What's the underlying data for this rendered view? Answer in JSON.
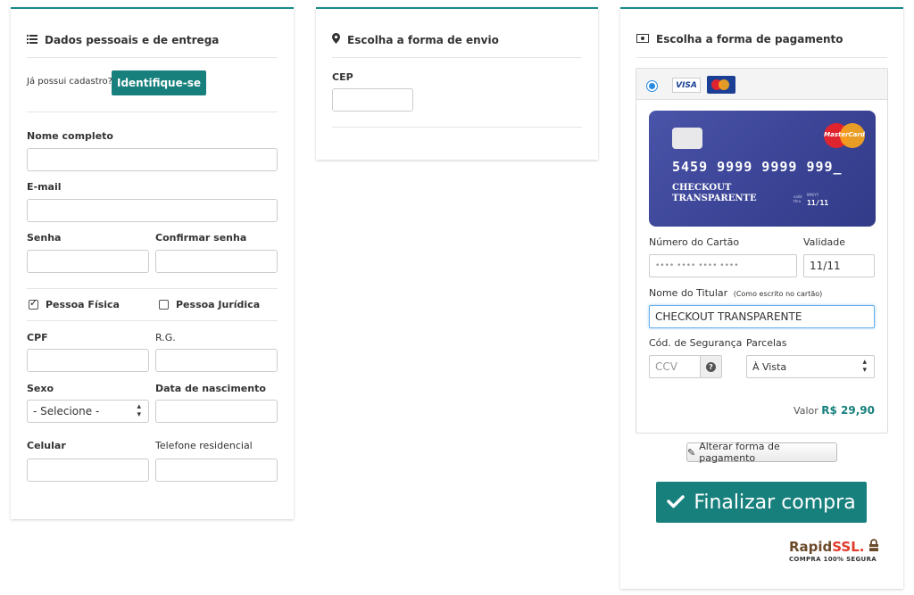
{
  "personal": {
    "title": "Dados pessoais e de entrega",
    "ja_possui": "Já possui cadastro?",
    "identifique": "Identifique-se",
    "nome_label": "Nome completo",
    "email_label": "E-mail",
    "senha_label": "Senha",
    "confirmar_label": "Confirmar senha",
    "pessoa_fisica": "Pessoa Física",
    "pessoa_juridica": "Pessoa Jurídica",
    "cpf_label": "CPF",
    "rg_label": "R.G.",
    "sexo_label": "Sexo",
    "sexo_value": "- Selecione -",
    "nascimento_label": "Data de nascimento",
    "celular_label": "Celular",
    "telefone_label": "Telefone residencial"
  },
  "shipping": {
    "title": "Escolha a forma de envio",
    "cep_label": "CEP"
  },
  "payment": {
    "title": "Escolha a forma de pagamento",
    "visa_label": "VISA",
    "card": {
      "brand": "MasterCard",
      "number": "5459 9999 9999 999_",
      "holder": "CHECKOUT TRANSPARENTE",
      "valid_label": "valid thru",
      "mmyy_label": "MM/YY",
      "exp": "11/11"
    },
    "numero_label": "Número do Cartão",
    "numero_placeholder": "•••• •••• •••• ••••",
    "validade_label": "Validade",
    "validade_value": "11/11",
    "titular_label": "Nome do Titular",
    "titular_hint": "(Como escrito no cartão)",
    "titular_value": "CHECKOUT TRANSPARENTE",
    "seguranca_label": "Cód. de Segurança",
    "ccv_placeholder": "CCV",
    "parcelas_label": "Parcelas",
    "parcelas_value": "À Vista",
    "valor_label": "Valor",
    "valor_amount": "R$ 29,90",
    "alterar": "Alterar forma de pagamento",
    "finalizar": "Finalizar compra",
    "rapid_main": "Rapid",
    "rapid_ssl": "SSL.",
    "rapid_sub": "COMPRA 100% SEGURA"
  },
  "colors": {
    "accent": "#17807d",
    "card": "#3c4597"
  }
}
